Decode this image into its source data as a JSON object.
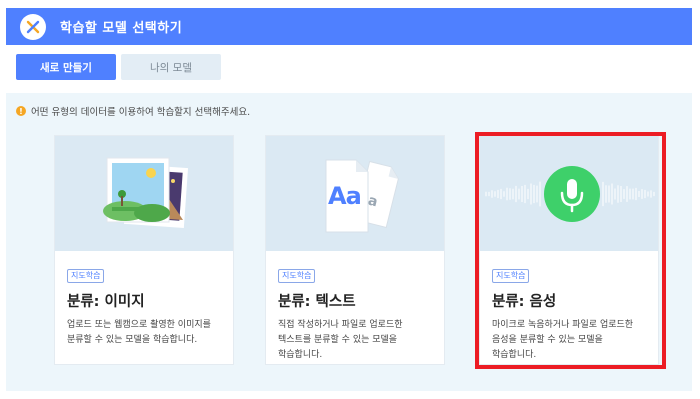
{
  "header": {
    "title": "학습할 모델 선택하기",
    "accent_color": "#4f80ff",
    "close_icon": "close-x-icon"
  },
  "tabs": [
    {
      "label": "새로 만들기",
      "active": true
    },
    {
      "label": "나의 모델",
      "active": false
    }
  ],
  "notice": {
    "icon": "exclamation-icon",
    "text": "어떤 유형의 데이터를 이용하여 학습할지 선택해주세요."
  },
  "cards": [
    {
      "tag": "지도학습",
      "title": "분류: 이미지",
      "description": "업로드 또는 웹캠으로 촬영한 이미지를 분류할 수 있는 모델을 학습합니다.",
      "icon": "picture-icon"
    },
    {
      "tag": "지도학습",
      "title": "분류: 텍스트",
      "description": "직접 작성하거나 파일로 업로드한 텍스트를 분류할 수 있는 모델을 학습합니다.",
      "icon": "text-document-icon",
      "icon_text": "Aa"
    },
    {
      "tag": "지도학습",
      "title": "분류: 음성",
      "description": "마이크로 녹음하거나 파일로 업로드한 음성을 분류할 수 있는 모델을 학습합니다.",
      "icon": "microphone-icon",
      "selected": true
    }
  ],
  "highlight_color": "#ec1c24"
}
